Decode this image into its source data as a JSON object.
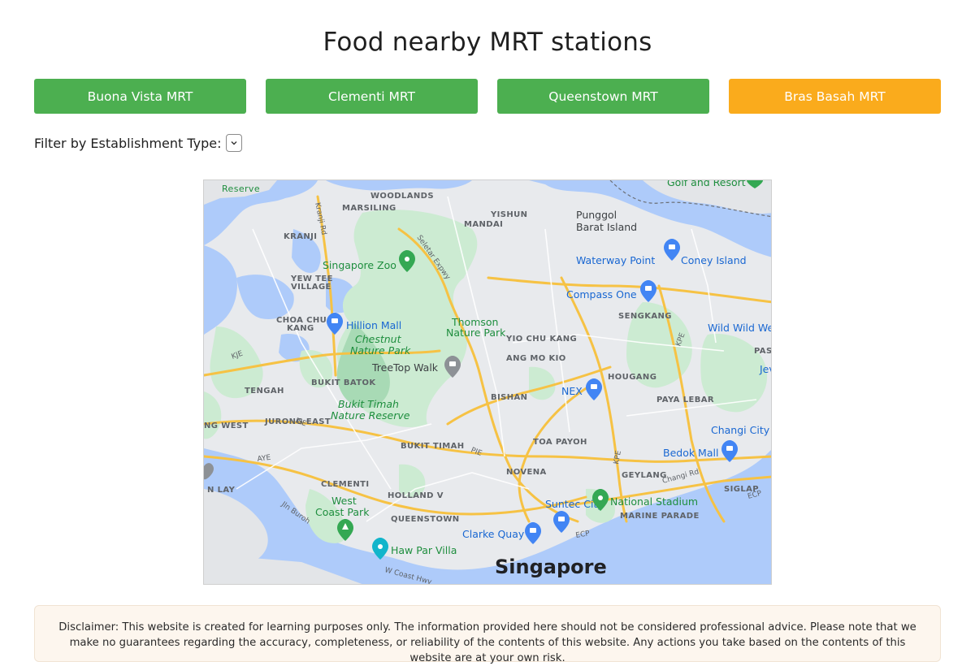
{
  "page": {
    "title": "Food nearby MRT stations"
  },
  "stations": [
    {
      "label": "Buona Vista MRT",
      "color": "#4caf50"
    },
    {
      "label": "Clementi MRT",
      "color": "#4caf50"
    },
    {
      "label": "Queenstown MRT",
      "color": "#4caf50"
    },
    {
      "label": "Bras Basah MRT",
      "color": "#faab1c"
    }
  ],
  "filter": {
    "label": "Filter by Establishment Type:",
    "selected": ""
  },
  "map": {
    "areas": {
      "reserve": "Reserve",
      "woodlands": "WOODLANDS",
      "marsiling": "MARSILING",
      "yishun": "YISHUN",
      "mandai": "MANDAI",
      "kranji": "KRANJI",
      "yew_tee": "YEW TEE",
      "village": "VILLAGE",
      "choa_chu_kang": "CHOA CHU",
      "kang": "KANG",
      "tengah": "TENGAH",
      "bukit_batok": "BUKIT BATOK",
      "yio_chu_kang": "YIO CHU KANG",
      "ang_mo_kio": "ANG MO KIO",
      "sengkang": "SENGKANG",
      "hougang": "HOUGANG",
      "bishan": "BISHAN",
      "paya_lebar": "PAYA LEBAR",
      "jurong_east": "JURONG EAST",
      "bukit_timah": "BUKIT TIMAH",
      "toa_payoh": "TOA PAYOH",
      "novena": "NOVENA",
      "geylang": "GEYLANG",
      "clementi": "CLEMENTI",
      "holland": "HOLLAND V",
      "queenstown": "QUEENSTOWN",
      "marine_parade": "MARINE PARADE",
      "siglap": "SIGLAP",
      "pasir": "PASI",
      "west": "NG WEST",
      "lay": "N LAY"
    },
    "places": {
      "punggol": "Punggol",
      "barat": "Barat Island",
      "waterway": "Waterway Point",
      "coney": "Coney Island",
      "compass": "Compass One",
      "zoo": "Singapore Zoo",
      "hillion": "Hillion Mall",
      "chestnut": "Chestnut",
      "chestnut2": "Nature Park",
      "thomson": "Thomson",
      "thomson2": "Nature Park",
      "treetop": "TreeTop Walk",
      "wild": "Wild Wild We",
      "nex": "NEX",
      "bukit_timah_nr": "Bukit Timah",
      "bukit_timah_nr2": "Nature Reserve",
      "changi": "Changi City",
      "bedok": "Bedok Mall",
      "national": "National Stadium",
      "suntec": "Suntec City",
      "west_coast": "West",
      "west_coast2": "Coast Park",
      "clarke": "Clarke Quay",
      "haw_par": "Haw Par Villa",
      "golf": "Golf and Resort",
      "singapore": "Singapore",
      "jev": "Jev"
    },
    "roads": {
      "seletar": "Seletar Expwy",
      "kranji_rd": "Kranji Rd",
      "kje": "KJE",
      "pie": "PIE",
      "pie2": "PIE",
      "aye": "AYE",
      "kpe": "KPE",
      "kpe2": "KPE",
      "ecp": "ECP",
      "ecp2": "ECP",
      "changi_rd": "Changi Rd",
      "jln_buroh": "Jln Buroh",
      "w_coast": "W Coast Hwy"
    }
  },
  "disclaimer": "Disclaimer: This website is created for learning purposes only. The information provided here should not be considered professional advice. Please note that we make no guarantees regarding the accuracy, completeness, or reliability of the contents of this website. Any actions you take based on the contents of this website are at your own risk."
}
